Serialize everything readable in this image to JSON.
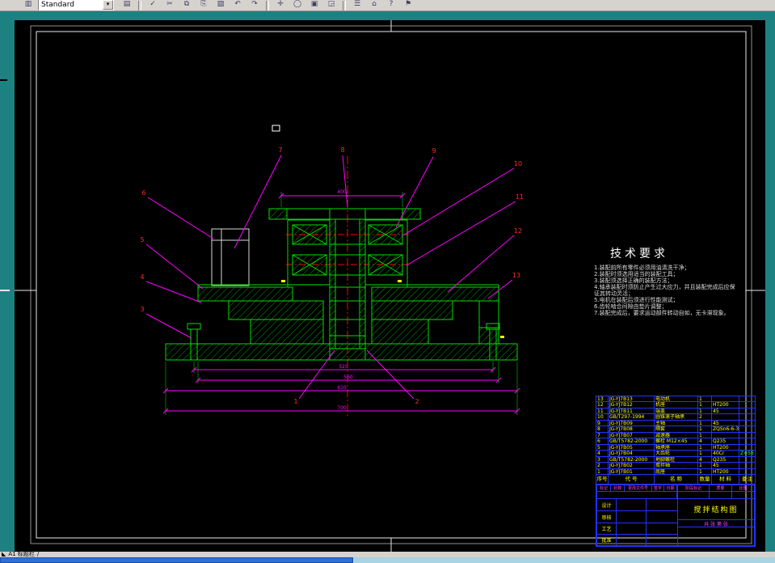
{
  "colors": {
    "workspace_teal": "#1d8181",
    "canvas_black": "#000000",
    "line_green": "#00dd00",
    "hatch_green": "#00a000",
    "dimension_magenta": "#ff00ff",
    "callout_red": "#ff2a2a",
    "table_blue": "#2233ff",
    "text_yellow": "#ffff00"
  },
  "toolbar": {
    "style_value": "Standard",
    "dropdown_arrow": "▾",
    "icons": [
      {
        "name": "standards-icon",
        "glyph": "▥"
      },
      {
        "name": "layers-icon",
        "glyph": "▤"
      },
      {
        "name": "spellcheck-icon",
        "glyph": "✓"
      },
      {
        "name": "cut-icon",
        "glyph": "✂"
      },
      {
        "name": "copy-icon",
        "glyph": "⧉"
      },
      {
        "name": "paste-icon",
        "glyph": "⎘"
      },
      {
        "name": "match-properties-icon",
        "glyph": "▨"
      },
      {
        "name": "undo-icon",
        "glyph": "↶"
      },
      {
        "name": "redo-icon",
        "glyph": "↷"
      },
      {
        "name": "pan-icon",
        "glyph": "✛"
      },
      {
        "name": "zoom-realtime-icon",
        "glyph": "◯"
      },
      {
        "name": "zoom-window-icon",
        "glyph": "▣"
      },
      {
        "name": "zoom-previous-icon",
        "glyph": "◲"
      },
      {
        "name": "properties-icon",
        "glyph": "☰"
      },
      {
        "name": "designcenter-icon",
        "glyph": "⌂"
      },
      {
        "name": "help-icon",
        "glyph": "?"
      },
      {
        "name": "publish-icon",
        "glyph": "⚑"
      }
    ]
  },
  "drawing": {
    "callouts": [
      "1",
      "2",
      "3",
      "4",
      "5",
      "6",
      "7",
      "8",
      "9",
      "10",
      "11",
      "12",
      "13"
    ],
    "dimensions": {
      "top": "400",
      "d1": "520",
      "d2": "560",
      "d3": "610",
      "d4": "700"
    }
  },
  "tech_requirements": {
    "title": "技术要求",
    "items": [
      "1.装配前所有零件必须用油清洗干净；",
      "2.装配时须选用适当的装配工具；",
      "3.装配须选择正确的装配方法；",
      "4.轴承装配时须防止产生过大应力，并且装配完成后应保证其转动灵活；",
      "5.电机在装配后须进行性能测试；",
      "6.齿轮啮合间隙由垫片调整；",
      "7.装配完成后，要求运动部件转动自如，无卡滞现象。"
    ]
  },
  "bom": {
    "headers": [
      "序号",
      "代  号",
      "名  称",
      "数量",
      "材  料",
      "备注"
    ],
    "rows": [
      {
        "no": "13",
        "code": "JG-YJ7B13",
        "name": "电动机",
        "qty": "1",
        "material": "",
        "remark": ""
      },
      {
        "no": "12",
        "code": "JG-YJ7B12",
        "name": "机座",
        "qty": "1",
        "material": "HT200",
        "remark": ""
      },
      {
        "no": "11",
        "code": "JG-YJ7B11",
        "name": "端盖",
        "qty": "1",
        "material": "45",
        "remark": ""
      },
      {
        "no": "10",
        "code": "GB/T297-1994",
        "name": "圆锥滚子轴承",
        "qty": "2",
        "material": "",
        "remark": ""
      },
      {
        "no": "9",
        "code": "JG-YJ7B09",
        "name": "主轴",
        "qty": "1",
        "material": "45",
        "remark": ""
      },
      {
        "no": "8",
        "code": "JG-YJ7B08",
        "name": "隔套",
        "qty": "1",
        "material": "ZQSn6-6-3",
        "remark": ""
      },
      {
        "no": "7",
        "code": "JG-YJ7B07",
        "name": "减速器",
        "qty": "1",
        "material": "",
        "remark": ""
      },
      {
        "no": "6",
        "code": "GB/T5782-2000",
        "name": "螺栓 M12×45",
        "qty": "4",
        "material": "Q235",
        "remark": ""
      },
      {
        "no": "5",
        "code": "JG-YJ7B05",
        "name": "轴承座",
        "qty": "1",
        "material": "HT200",
        "remark": ""
      },
      {
        "no": "4",
        "code": "JG-YJ7B04",
        "name": "大齿轮",
        "qty": "1",
        "material": "40Cr",
        "remark": "Z=56"
      },
      {
        "no": "3",
        "code": "GB/T5782-2000",
        "name": "地脚螺栓",
        "qty": "4",
        "material": "Q235",
        "remark": ""
      },
      {
        "no": "2",
        "code": "JG-YJ7B02",
        "name": "搅拌轴",
        "qty": "1",
        "material": "45",
        "remark": ""
      },
      {
        "no": "1",
        "code": "JG-YJ7B01",
        "name": "底座",
        "qty": "1",
        "material": "HT200",
        "remark": ""
      }
    ]
  },
  "title_block": {
    "drawing_title": "搅拌结构图",
    "header_cells": [
      "标记",
      "处数",
      "更改文件号",
      "签字",
      "日期"
    ],
    "staff_rows": [
      "设计",
      "审核",
      "工艺",
      "批准"
    ],
    "stage_label": "阶段标记",
    "weight_label": "质量",
    "scale_label": "比例",
    "sheet_label": "共 张 第 张"
  },
  "status": {
    "corner_glyph": "◣",
    "tab_label": "A1 标题栏",
    "divider": "/"
  }
}
